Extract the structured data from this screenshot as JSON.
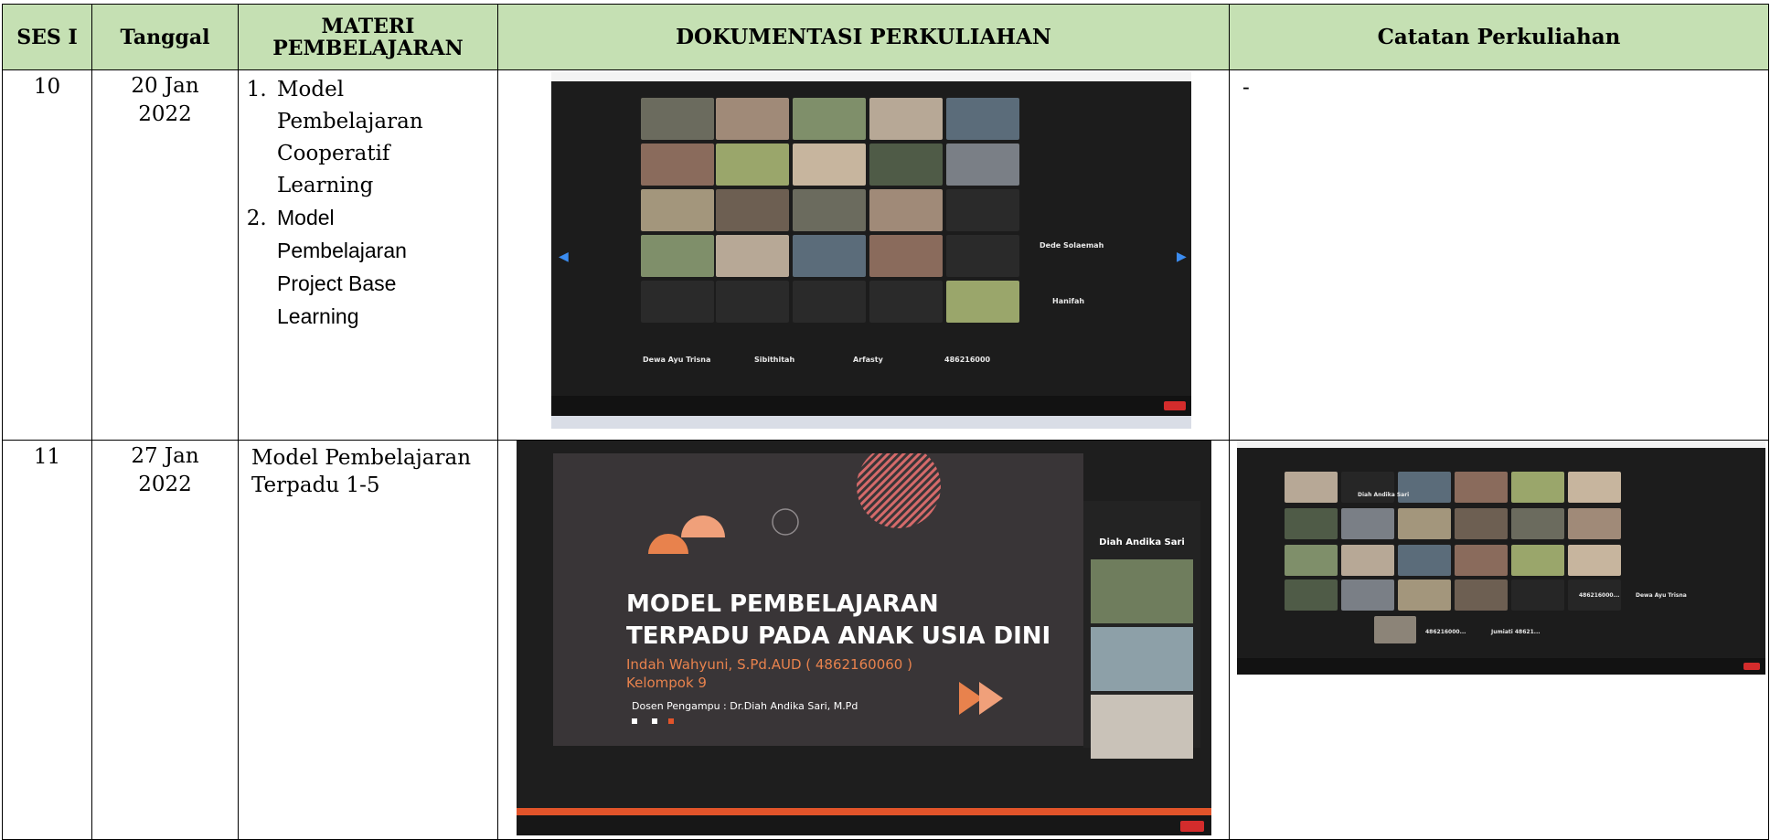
{
  "table": {
    "headers": {
      "sesi": "SES I",
      "tanggal": "Tanggal",
      "materi": "MATERI PEMBELAJARAN",
      "dokumentasi": "DOKUMENTASI PERKULIAHAN",
      "catatan": "Catatan Perkuliahan"
    },
    "rows": [
      {
        "sesi": "10",
        "tanggal": [
          "20 Jan",
          "2022"
        ],
        "materi": [
          "Model",
          "Pembelajaran",
          "Cooperatif",
          "Learning",
          "Model",
          "Pembelajaran",
          "Project Base",
          "Learning"
        ],
        "catatan": "-",
        "doc": {
          "names": [
            "Dede Solaemah",
            "Hanifah",
            "Dewa Ayu Trisna",
            "Sibithitah",
            "Arfasty",
            "486216000"
          ]
        }
      },
      {
        "sesi": "11",
        "tanggal": [
          "27 Jan",
          "2022"
        ],
        "materi": [
          "Model Pembelajaran",
          "Terpadu 1-5"
        ],
        "doc": {
          "slide_title_1": "MODEL PEMBELAJARAN",
          "slide_title_2": "TERPADU PADA ANAK USIA DINI",
          "slide_presenter": "Indah Wahyuni, S.Pd.AUD ( 4862160060 )",
          "slide_group": "Kelompok 9",
          "slide_dosen": "Dosen Pengampu : Dr.Diah Andika Sari, M.Pd",
          "side_name": "Diah Andika Sari"
        },
        "catatan_doc": {
          "names": [
            "Diah Andika Sari",
            "486216000...",
            "Dewa Ayu Trisna",
            "486216000...",
            "Jumiati 48621..."
          ]
        }
      }
    ]
  },
  "colors": {
    "header_bg": "#c5e0b3",
    "zoom_bg": "#1c1c1c",
    "slide_bg": "#393537",
    "slide_accent": "#e8824d",
    "leave_red": "#d32c2c"
  }
}
